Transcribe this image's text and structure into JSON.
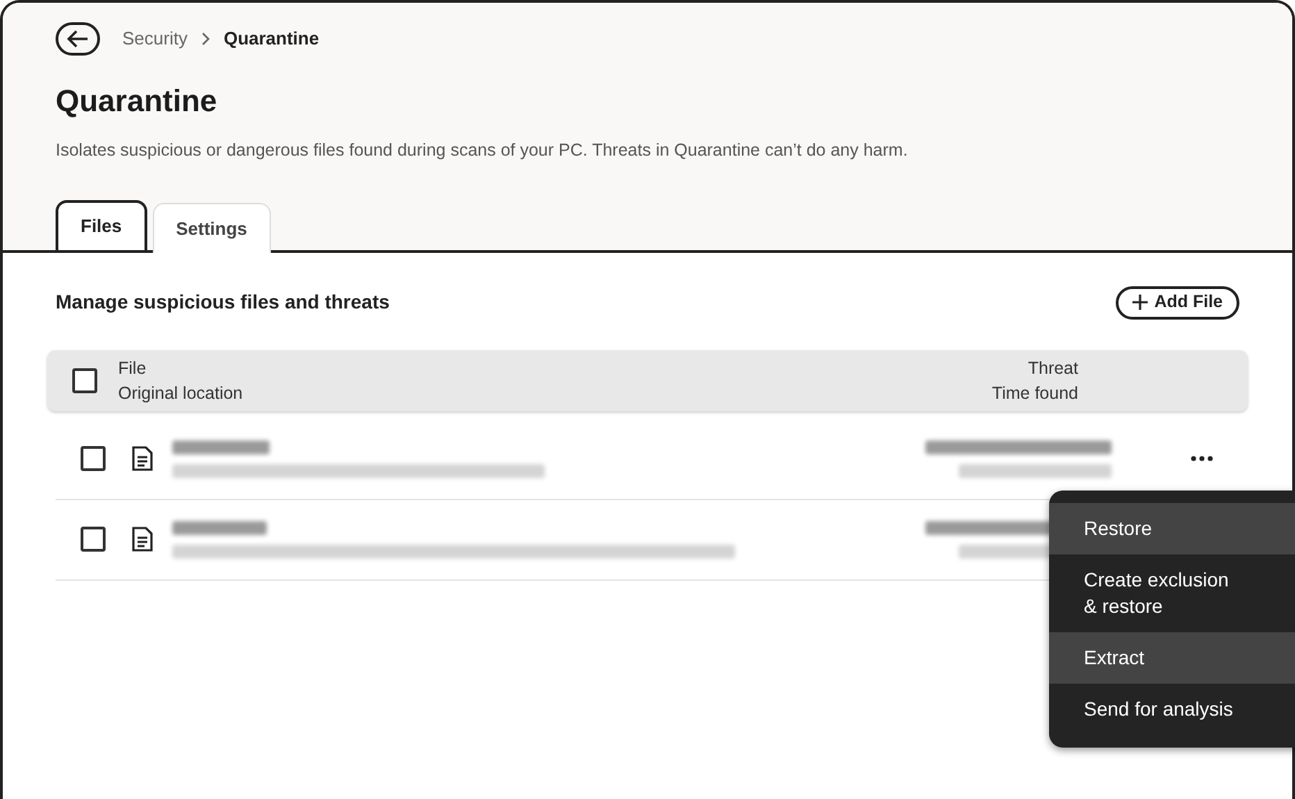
{
  "breadcrumb": {
    "parent": "Security",
    "current": "Quarantine"
  },
  "title": "Quarantine",
  "description": "Isolates suspicious or dangerous files found during scans of your PC. Threats in Quarantine can’t do any harm.",
  "tabs": [
    {
      "label": "Files",
      "selected": true
    },
    {
      "label": "Settings",
      "selected": false
    }
  ],
  "section_title": "Manage suspicious files and threats",
  "add_button": "Add File",
  "table": {
    "select_all_checked": false,
    "columns": [
      {
        "top": "File",
        "bottom": "Original location"
      },
      {
        "top": "Threat",
        "bottom": "Time found"
      }
    ],
    "rows": [
      {
        "checked": false,
        "more_button": true
      },
      {
        "checked": false,
        "more_button": false
      }
    ]
  },
  "menu": [
    {
      "label": "Restore",
      "highlighted": true
    },
    {
      "label": "Create exclusion\n& restore",
      "highlighted": false
    },
    {
      "label": "Extract",
      "highlighted": true
    },
    {
      "label": "Send for analysis",
      "highlighted": false
    }
  ]
}
